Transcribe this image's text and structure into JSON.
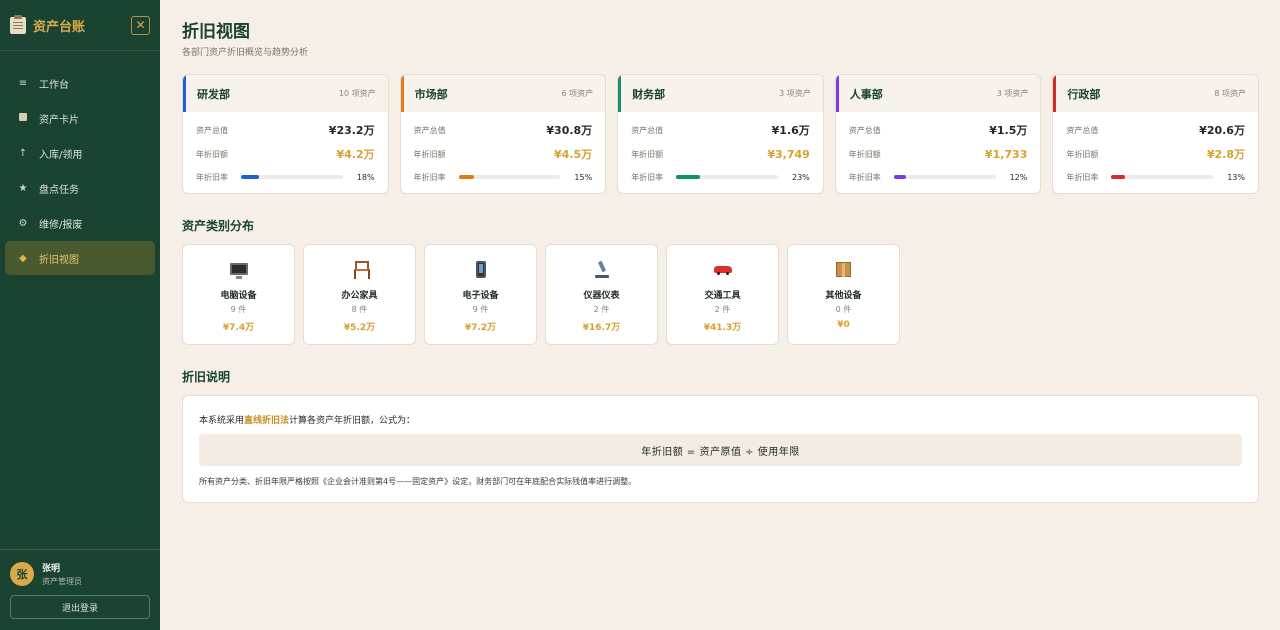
{
  "sidebar": {
    "title": "资产台账",
    "close_glyph": "✕",
    "items": [
      {
        "label": "工作台",
        "icon": "≡"
      },
      {
        "label": "资产卡片",
        "icon": ""
      },
      {
        "label": "入库/领用",
        "icon": "↑"
      },
      {
        "label": "盘点任务",
        "icon": "★"
      },
      {
        "label": "维修/报废",
        "icon": "⚙"
      },
      {
        "label": "折旧视图",
        "icon": "◆"
      }
    ],
    "active_index": 5,
    "user": {
      "avatar": "张",
      "name": "张明",
      "role": "资产管理员"
    },
    "logout_label": "退出登录"
  },
  "header": {
    "title": "折旧视图",
    "subtitle": "各部门资产折旧概览与趋势分析"
  },
  "labels": {
    "total": "资产总值",
    "annual": "年折旧额",
    "rate": "年折旧率"
  },
  "departments": [
    {
      "name": "研发部",
      "count": "10 项资产",
      "total": "¥23.2万",
      "annual": "¥4.2万",
      "rate": "18%",
      "rate_value": 0.18,
      "color": "#1f5fd6"
    },
    {
      "name": "市场部",
      "count": "6 项资产",
      "total": "¥30.8万",
      "annual": "¥4.5万",
      "rate": "15%",
      "rate_value": 0.15,
      "color": "#e07a1a"
    },
    {
      "name": "财务部",
      "count": "3 项资产",
      "total": "¥1.6万",
      "annual": "¥3,749",
      "rate": "23%",
      "rate_value": 0.23,
      "color": "#139068"
    },
    {
      "name": "人事部",
      "count": "3 项资产",
      "total": "¥1.5万",
      "annual": "¥1,733",
      "rate": "12%",
      "rate_value": 0.12,
      "color": "#7c3aed"
    },
    {
      "name": "行政部",
      "count": "8 项资产",
      "total": "¥20.6万",
      "annual": "¥2.8万",
      "rate": "13%",
      "rate_value": 0.13,
      "color": "#d42b2b"
    }
  ],
  "categories_title": "资产类别分布",
  "categories": [
    {
      "name": "电脑设备",
      "count": "9 件",
      "value": "¥7.4万",
      "icon": "monitor-icon"
    },
    {
      "name": "办公家具",
      "count": "8 件",
      "value": "¥5.2万",
      "icon": "chair-icon"
    },
    {
      "name": "电子设备",
      "count": "9 件",
      "value": "¥7.2万",
      "icon": "phone-icon"
    },
    {
      "name": "仪器仪表",
      "count": "2 件",
      "value": "¥16.7万",
      "icon": "microscope-icon"
    },
    {
      "name": "交通工具",
      "count": "2 件",
      "value": "¥41.3万",
      "icon": "car-icon"
    },
    {
      "name": "其他设备",
      "count": "0 件",
      "value": "¥0",
      "icon": "package-icon"
    }
  ],
  "explanation": {
    "title": "折旧说明",
    "line_prefix": "本系统采用",
    "method": "直线折旧法",
    "line_suffix": "计算各资产年折旧额，公式为：",
    "formula": "年折旧额 = 资产原值 ÷ 使用年限",
    "note": "所有资产分类、折旧年限严格按照《企业会计准则第4号——固定资产》设定，财务部门可在年底配合实际残值率进行调整。"
  }
}
